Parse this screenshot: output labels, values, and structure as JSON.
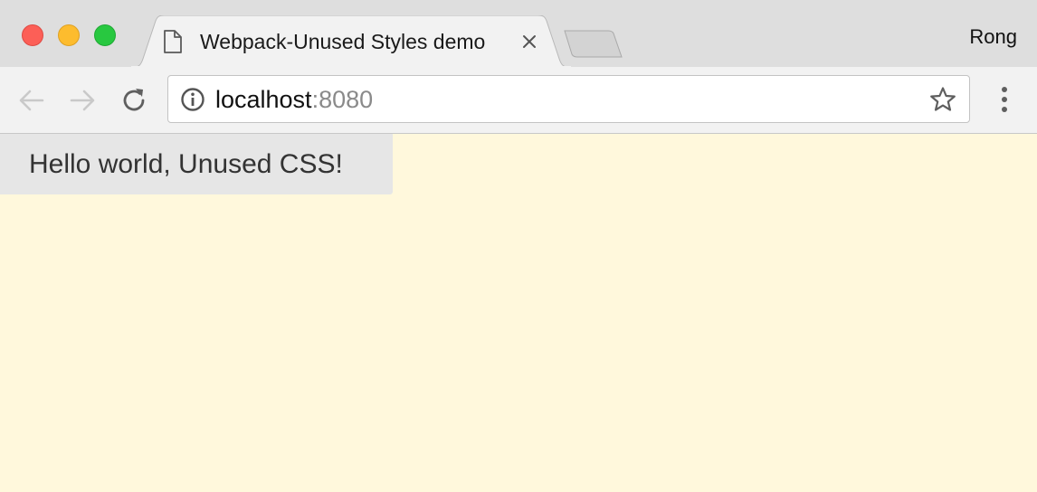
{
  "window": {
    "controls": [
      "close",
      "minimize",
      "maximize"
    ],
    "profile_name": "Rong"
  },
  "tabs": [
    {
      "title": "Webpack-Unused Styles demo",
      "icon": "document-icon",
      "active": true
    }
  ],
  "toolbar": {
    "back_icon": "arrow-left-icon",
    "forward_icon": "arrow-right-icon",
    "reload_icon": "reload-icon",
    "menu_icon": "more-vertical-icon"
  },
  "address_bar": {
    "host": "localhost",
    "port": ":8080",
    "security_icon": "info-icon",
    "bookmark_icon": "star-icon"
  },
  "page": {
    "background_color": "#fff8dc",
    "heading": "Hello world, Unused CSS!",
    "heading_background": "#e6e6e6"
  }
}
